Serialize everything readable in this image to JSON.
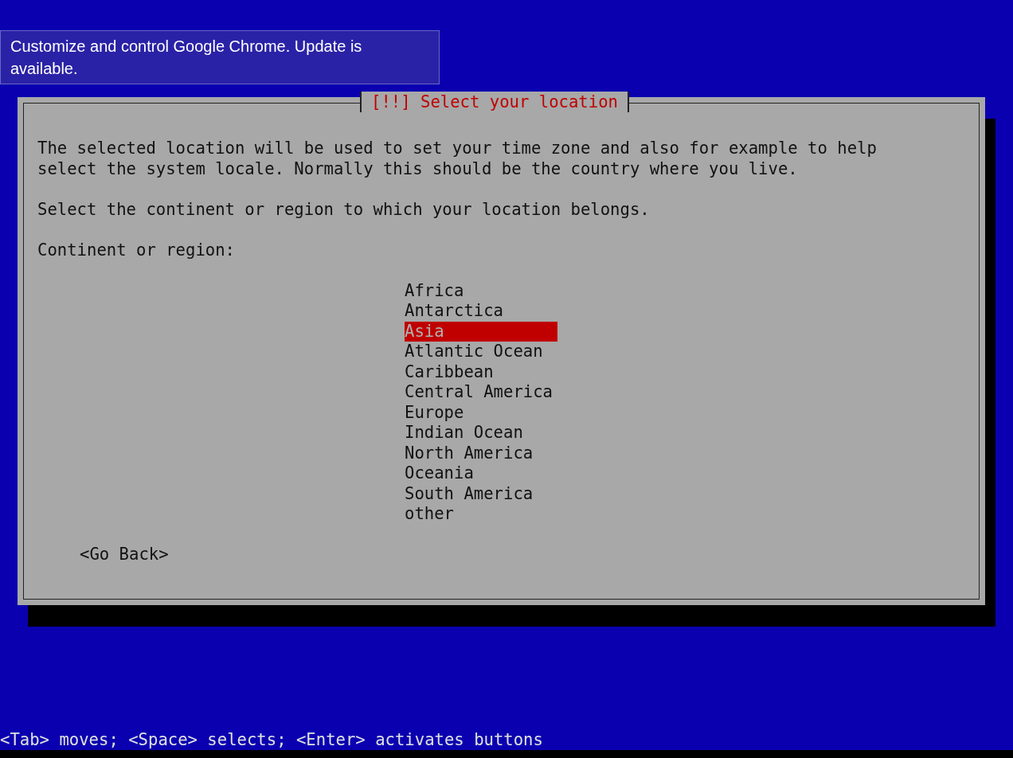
{
  "tooltip": {
    "text": "Customize and control Google Chrome. Update is available."
  },
  "dialog": {
    "title": "[!!] Select your location",
    "description": [
      "The selected location will be used to set your time zone and also for example to help",
      "select the system locale. Normally this should be the country where you live."
    ],
    "instruction": "Select the continent or region to which your location belongs.",
    "list_label": "Continent or region:",
    "items": [
      {
        "label": "Africa",
        "selected": false
      },
      {
        "label": "Antarctica",
        "selected": false
      },
      {
        "label": "Asia",
        "selected": true
      },
      {
        "label": "Atlantic Ocean",
        "selected": false
      },
      {
        "label": "Caribbean",
        "selected": false
      },
      {
        "label": "Central America",
        "selected": false
      },
      {
        "label": "Europe",
        "selected": false
      },
      {
        "label": "Indian Ocean",
        "selected": false
      },
      {
        "label": "North America",
        "selected": false
      },
      {
        "label": "Oceania",
        "selected": false
      },
      {
        "label": "South America",
        "selected": false
      },
      {
        "label": "other",
        "selected": false
      }
    ],
    "back_button": "<Go Back>"
  },
  "status_bar": {
    "text": "<Tab> moves; <Space> selects; <Enter> activates buttons"
  }
}
